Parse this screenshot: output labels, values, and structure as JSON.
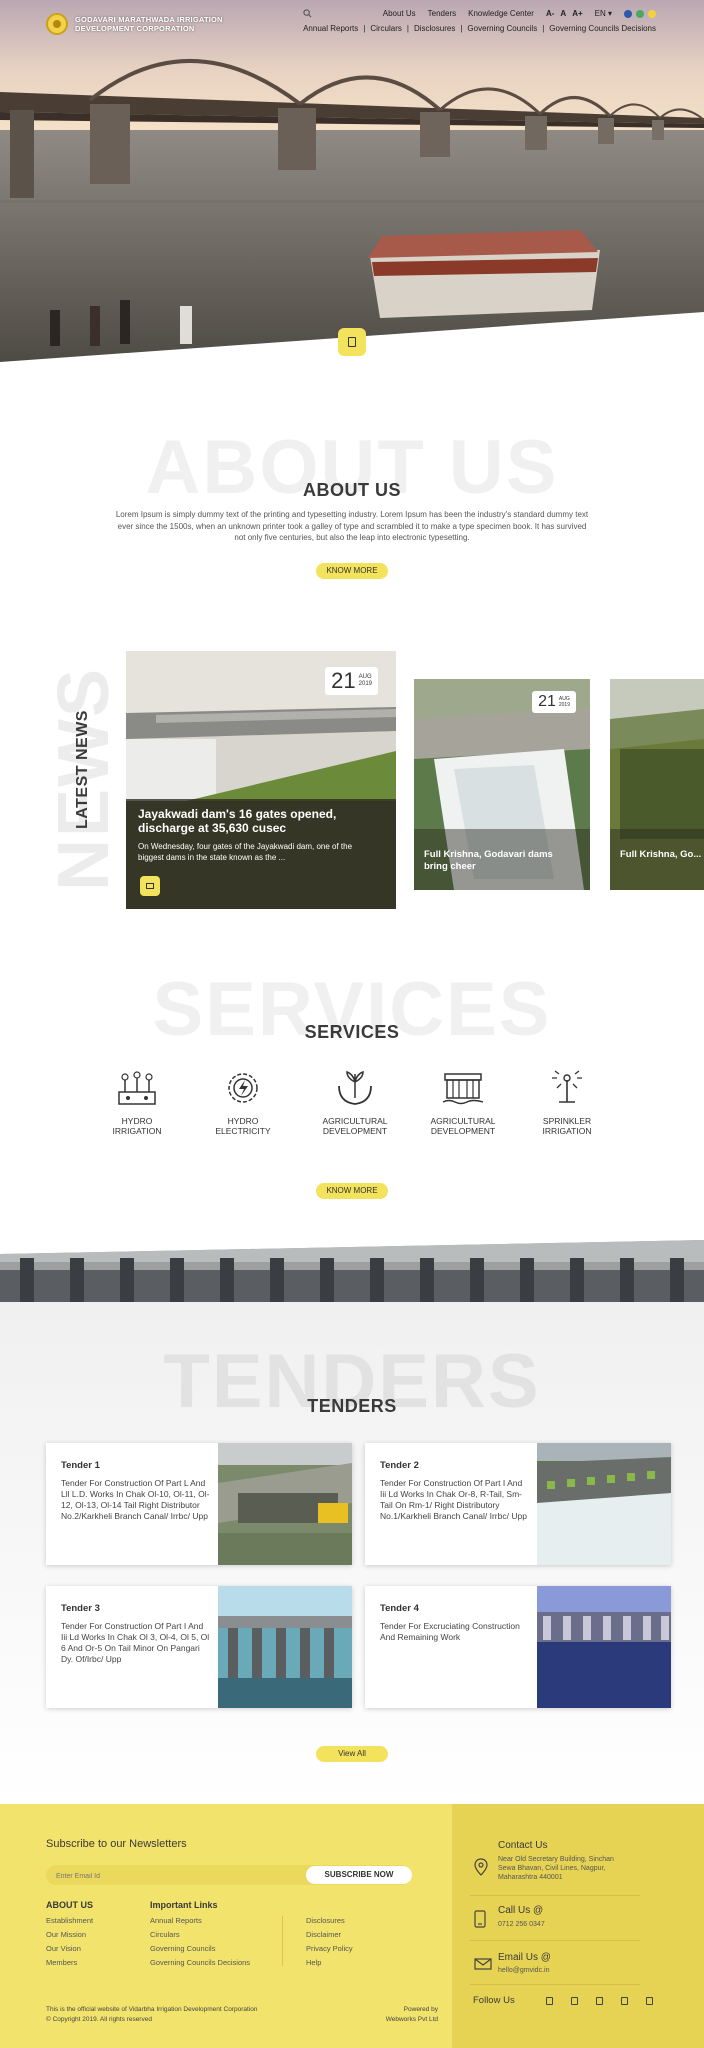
{
  "header": {
    "logo_line1": "GODAVARI MARATHWADA IRRIGATION",
    "logo_line2": "DEVELOPMENT CORPORATION",
    "nav_row1": [
      "About Us",
      "Tenders",
      "Knowledge Center"
    ],
    "font_sizes": [
      "A-",
      "A",
      "A+"
    ],
    "language": "EN ▾",
    "theme_colors": [
      "#2b5aa8",
      "#4aa860",
      "#f2d23a"
    ],
    "nav_row2": [
      "Annual Reports",
      "|",
      "Circulars",
      "|",
      "Disclosures",
      "|",
      "Governing Councils",
      "|",
      "Governing Councils Decisions"
    ]
  },
  "about": {
    "watermark": "ABOUT US",
    "title": "ABOUT US",
    "text": "Lorem Ipsum is simply dummy text of the printing and typesetting industry. Lorem Ipsum has been the industry's standard dummy text ever since the 1500s, when an unknown printer took a galley of type and scrambled it to make a type specimen book. It has survived not only five centuries, but also the leap into electronic typesetting.",
    "button": "KNOW MORE"
  },
  "news": {
    "watermark": "NEWS",
    "title": "LATEST NEWS",
    "items": [
      {
        "day": "21",
        "month": "AUG",
        "year": "2019",
        "title": "Jayakwadi dam's 16 gates opened, discharge at 35,630 cusec",
        "desc": "On Wednesday, four gates of the Jayakwadi dam, one of the biggest dams in the state known as the ..."
      },
      {
        "day": "21",
        "month": "AUG",
        "year": "2019",
        "title": "Full Krishna, Godavari dams bring cheer"
      },
      {
        "title": "Full Krishna, Go... bring cheer"
      }
    ]
  },
  "services": {
    "watermark": "SERVICES",
    "title": "SERVICES",
    "items": [
      {
        "l1": "HYDRO",
        "l2": "IRRIGATION"
      },
      {
        "l1": "HYDRO",
        "l2": "ELECTRICITY"
      },
      {
        "l1": "AGRICULTURAL",
        "l2": "DEVELOPMENT"
      },
      {
        "l1": "AGRICULTURAL",
        "l2": "DEVELOPMENT"
      },
      {
        "l1": "SPRINKLER",
        "l2": "IRRIGATION"
      }
    ],
    "button": "KNOW MORE"
  },
  "tenders": {
    "watermark": "TENDERS",
    "title": "TENDERS",
    "items": [
      {
        "title": "Tender 1",
        "desc": "Tender For Construction Of Part L And Lll L.D. Works In Chak Ol-10, Ol-11, Ol-12, Ol-13, Ol-14 Tail Right Distributor No.2/Karkheli Branch Canal/ Irrbc/ Upp"
      },
      {
        "title": "Tender 2",
        "desc": "Tender For Construction Of Part I And Iii Ld Works In Chak Or-8, R-Tail, Sm-Tail On Rm-1/ Right Distributory No.1/Karkheli Branch Canal/ Irrbc/ Upp"
      },
      {
        "title": "Tender 3",
        "desc": "Tender For Construction Of Part I And Iii Ld Works In Chak Ol 3, Ol-4, Ol 5, Ol 6 And Or-5 On Tail Minor On Pangari Dy. Of/Irbc/ Upp"
      },
      {
        "title": "Tender 4",
        "desc": "Tender For Excruciating Construction And Remaining Work"
      }
    ],
    "button": "View All"
  },
  "footer": {
    "newsletter_title": "Subscribe to our Newsletters",
    "email_placeholder": "Enter Email Id",
    "subscribe": "SUBSCRIBE NOW",
    "about_title": "ABOUT US",
    "about_links": [
      "Establishment",
      "Our Mission",
      "Our Vision",
      "Members"
    ],
    "links_title": "Important Links",
    "links_col1": [
      "Annual Reports",
      "Circulars",
      "Governing Councils",
      "Governing Councils Decisions"
    ],
    "links_col2": [
      "Disclosures",
      "Disclaimer",
      "Privacy Policy",
      "Help"
    ],
    "copyright1": "This is the official website of Vidarbha Irrigation Development Corporation",
    "copyright2": "© Copyright 2019. All rights reserved",
    "powered1": "Powered by",
    "powered2": "Webworks Pvt Ltd",
    "contact_title": "Contact Us",
    "address": [
      "Near Old Secretary Building, Sinchan",
      "Sewa Bhavan, Civil Lines, Nagpur,",
      "Maharashtra 440001"
    ],
    "call_title": "Call Us @",
    "phone": "0712 256 0347",
    "email_title": "Email Us @",
    "email": "hello@gmvidc.in",
    "follow": "Follow Us",
    "social": [
      "facebook-icon",
      "twitter-icon",
      "instagram-icon",
      "linkedin-icon",
      "youtube-icon"
    ]
  }
}
